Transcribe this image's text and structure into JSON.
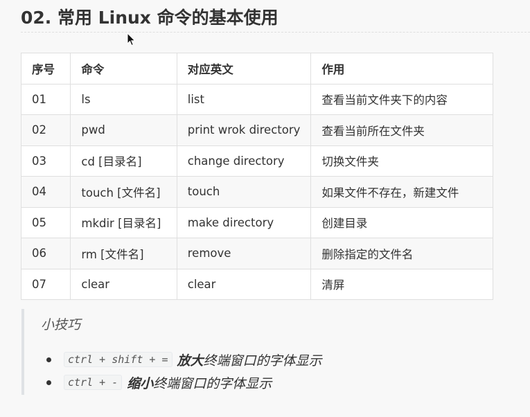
{
  "heading": "02. 常用 Linux 命令的基本使用",
  "table": {
    "headers": [
      "序号",
      "命令",
      "对应英文",
      "作用"
    ],
    "rows": [
      [
        "01",
        "ls",
        "list",
        "查看当前文件夹下的内容"
      ],
      [
        "02",
        "pwd",
        "print wrok directory",
        "查看当前所在文件夹"
      ],
      [
        "03",
        "cd [目录名]",
        "change directory",
        "切换文件夹"
      ],
      [
        "04",
        "touch [文件名]",
        "touch",
        "如果文件不存在，新建文件"
      ],
      [
        "05",
        "mkdir [目录名]",
        "make directory",
        "创建目录"
      ],
      [
        "06",
        "rm [文件名]",
        "remove",
        "删除指定的文件名"
      ],
      [
        "07",
        "clear",
        "clear",
        "清屏"
      ]
    ]
  },
  "tips": {
    "title": "小技巧",
    "items": [
      {
        "shortcut": "ctrl + shift + =",
        "emphasis": "放大",
        "text": "终端窗口的字体显示"
      },
      {
        "shortcut": "ctrl + -",
        "emphasis": "缩小",
        "text": "终端窗口的字体显示"
      }
    ]
  },
  "cursor_icon": "arrow-pointer-icon"
}
